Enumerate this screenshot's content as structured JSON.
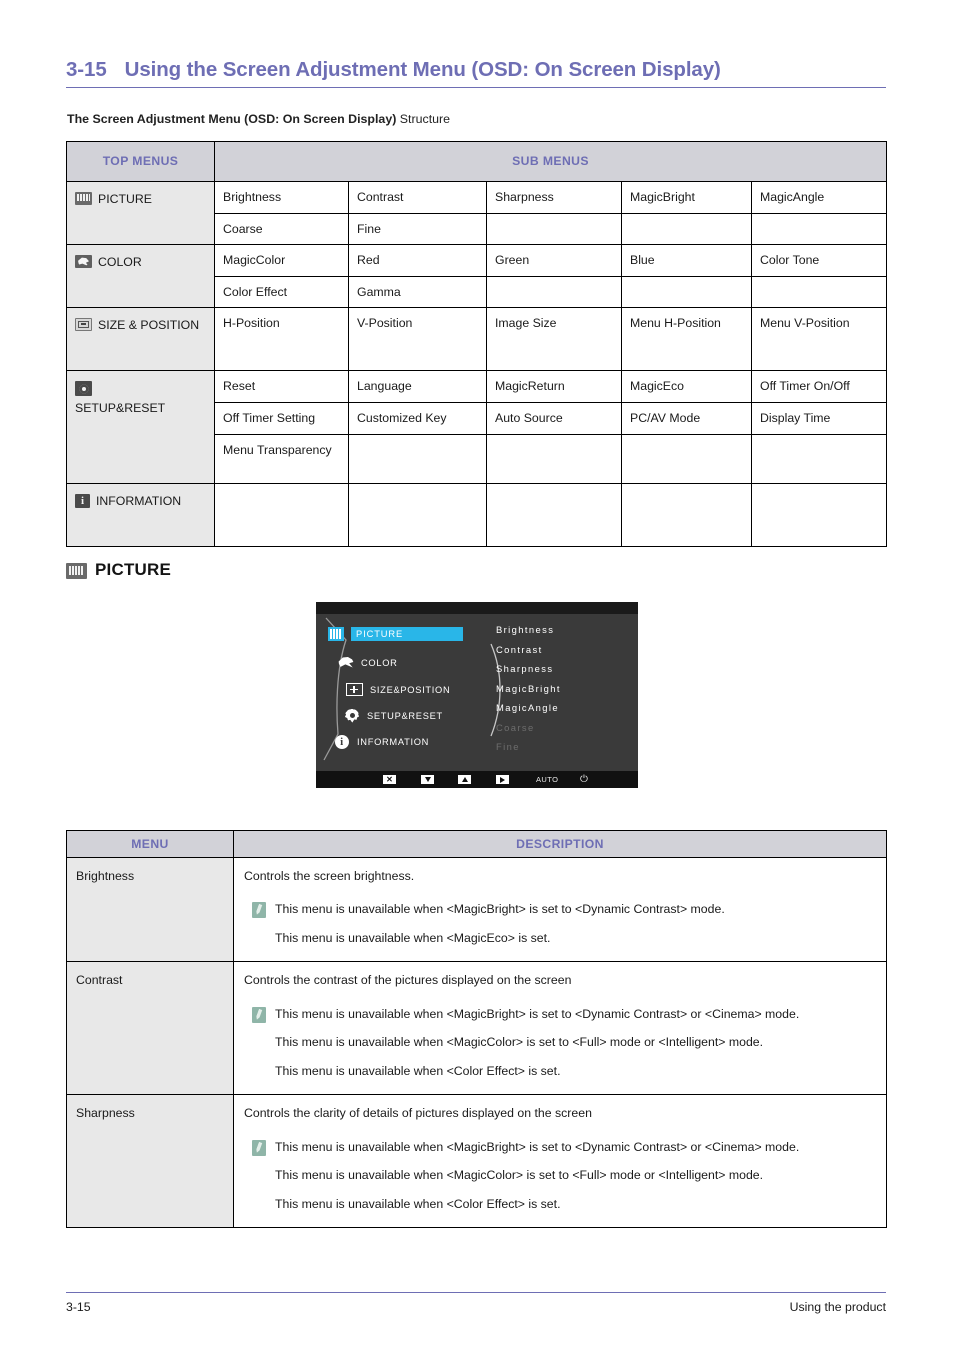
{
  "heading": {
    "number": "3-15",
    "title": "Using the Screen Adjustment Menu (OSD: On Screen Display)"
  },
  "structure_caption": {
    "bold": "The Screen Adjustment Menu (OSD: On Screen Display)",
    "plain": "Structure"
  },
  "structure_table": {
    "headers": {
      "top_menus": "TOP MENUS",
      "sub_menus": "SUB MENUS"
    },
    "groups": [
      {
        "icon": "picture-icon",
        "label": "PICTURE",
        "rows": [
          [
            "Brightness",
            "Contrast",
            "Sharpness",
            "MagicBright",
            "MagicAngle"
          ],
          [
            "Coarse",
            "Fine",
            "",
            "",
            ""
          ]
        ]
      },
      {
        "icon": "color-icon",
        "label": "COLOR",
        "rows": [
          [
            "MagicColor",
            "Red",
            "Green",
            "Blue",
            "Color Tone"
          ],
          [
            "Color Effect",
            "Gamma",
            "",
            "",
            ""
          ]
        ]
      },
      {
        "icon": "size-position-icon",
        "label": "SIZE & POSITION",
        "rows": [
          [
            "H-Position",
            "V-Position",
            "Image Size",
            "Menu H-Position",
            "Menu V-Position"
          ]
        ]
      },
      {
        "icon": "setup-reset-icon",
        "label": "SETUP&RESET",
        "rows": [
          [
            "Reset",
            "Language",
            "MagicReturn",
            "MagicEco",
            "Off Timer On/Off"
          ],
          [
            "Off Timer Setting",
            "Customized Key",
            "Auto Source",
            "PC/AV Mode",
            "Display Time"
          ],
          [
            "Menu Transparency",
            "",
            "",
            "",
            ""
          ]
        ]
      },
      {
        "icon": "information-icon",
        "label": "INFORMATION",
        "rows": [
          [
            "",
            "",
            "",
            "",
            ""
          ]
        ]
      }
    ]
  },
  "section": {
    "icon": "picture-icon",
    "title": "PICTURE"
  },
  "osd": {
    "colors": {
      "background": "#3a3a3a",
      "highlight": "#29b6e8",
      "bar": "#111111",
      "text": "#ffffff",
      "dim_text": "#6d6d6d"
    },
    "left_items": [
      {
        "label": "PICTURE",
        "icon": "picture-icon",
        "selected": true
      },
      {
        "label": "COLOR",
        "icon": "color-icon",
        "selected": false
      },
      {
        "label": "SIZE&POSITION",
        "icon": "size-position-icon",
        "selected": false
      },
      {
        "label": "SETUP&RESET",
        "icon": "setup-reset-icon",
        "selected": false
      },
      {
        "label": "INFORMATION",
        "icon": "information-icon",
        "selected": false
      }
    ],
    "sub_items": [
      {
        "label": "Brightness",
        "disabled": false
      },
      {
        "label": "Contrast",
        "disabled": false
      },
      {
        "label": "Sharpness",
        "disabled": false
      },
      {
        "label": "MagicBright",
        "disabled": false
      },
      {
        "label": "MagicAngle",
        "disabled": false
      },
      {
        "label": "Coarse",
        "disabled": true
      },
      {
        "label": "Fine",
        "disabled": true
      }
    ],
    "buttons": [
      {
        "name": "exit-button",
        "glyph": "X"
      },
      {
        "name": "down-button",
        "glyph": "▼"
      },
      {
        "name": "up-button",
        "glyph": "▲"
      },
      {
        "name": "enter-button",
        "glyph": "▶"
      },
      {
        "name": "auto-button",
        "glyph": "AUTO"
      },
      {
        "name": "power-button",
        "glyph": "⏻"
      }
    ]
  },
  "description_table": {
    "headers": {
      "menu": "MENU",
      "description": "DESCRIPTION"
    },
    "rows": [
      {
        "menu": "Brightness",
        "lead": "Controls the screen brightness.",
        "notes": [
          "This menu is unavailable when <MagicBright> is set to <Dynamic Contrast> mode.",
          "This menu is unavailable when <MagicEco> is set."
        ]
      },
      {
        "menu": "Contrast",
        "lead": "Controls the contrast of the pictures displayed on the screen",
        "notes": [
          "This menu is unavailable when <MagicBright> is set to <Dynamic Contrast> or <Cinema> mode.",
          "This menu is unavailable when <MagicColor> is set to <Full> mode or <Intelligent> mode.",
          "This menu is unavailable when <Color Effect> is set."
        ]
      },
      {
        "menu": "Sharpness",
        "lead": "Controls the clarity of details of pictures displayed on the screen",
        "notes": [
          "This menu is unavailable when <MagicBright> is set to <Dynamic Contrast> or <Cinema> mode.",
          "This menu is unavailable when <MagicColor> is set to <Full> mode or <Intelligent> mode.",
          "This menu is unavailable when <Color Effect> is set."
        ]
      }
    ]
  },
  "footer": {
    "page_number": "3-15",
    "section_name": "Using the product"
  }
}
